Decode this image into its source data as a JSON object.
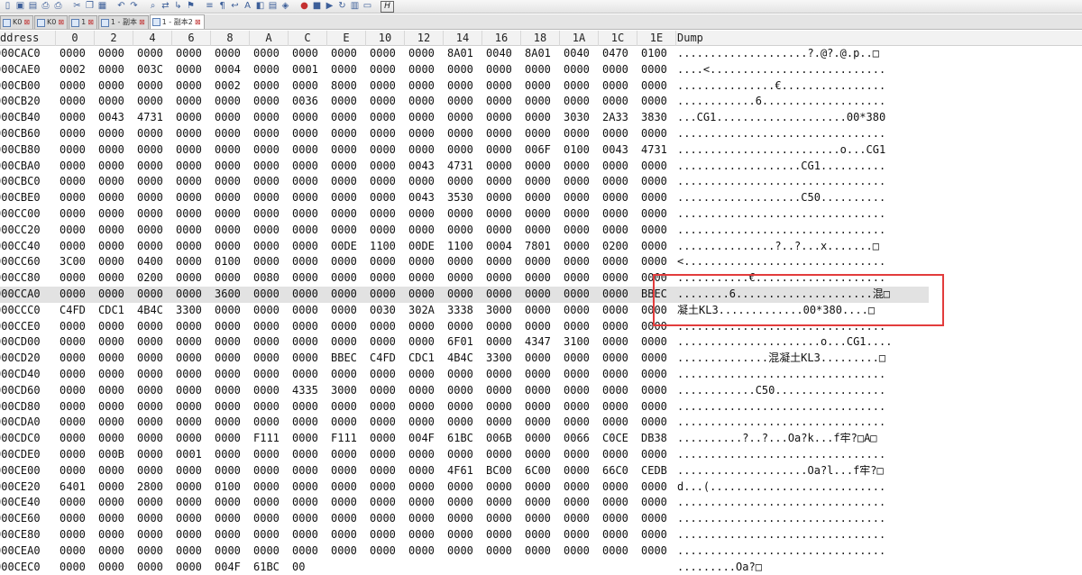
{
  "toolbar": {
    "icons": [
      "new-file-icon",
      "save-icon",
      "save-all-icon",
      "print-preview-icon",
      "print-icon",
      "cut-icon",
      "copy-icon",
      "paste-icon",
      "undo-icon",
      "redo-icon",
      "find-icon",
      "replace-icon",
      "goto-icon",
      "bookmark-icon",
      "compare-icon",
      "column-icon",
      "wrap-icon",
      "font-icon",
      "color-icon",
      "format-icon",
      "tag-icon",
      "record-macro-icon",
      "stop-macro-icon",
      "play-macro-icon",
      "repeat-macro-icon",
      "save-macro-icon",
      "window-icon",
      "hex-mode-icon"
    ],
    "hex_button_label": "H"
  },
  "tabs": [
    {
      "label": "K0",
      "active": false
    },
    {
      "label": "K0",
      "active": false
    },
    {
      "label": "1",
      "active": false
    },
    {
      "label": "1 - 副本",
      "active": false
    },
    {
      "label": "1 - 副本2",
      "active": true
    }
  ],
  "header": {
    "address": "ddress",
    "columns": [
      "0",
      "2",
      "4",
      "6",
      "8",
      "A",
      "C",
      "E",
      "10",
      "12",
      "14",
      "16",
      "18",
      "1A",
      "1C",
      "1E"
    ],
    "dump": "Dump"
  },
  "rows": [
    {
      "addr": "000CAC0",
      "words": [
        "0000",
        "0000",
        "0000",
        "0000",
        "0000",
        "0000",
        "0000",
        "0000",
        "0000",
        "0000",
        "8A01",
        "0040",
        "8A01",
        "0040",
        "0470",
        "0100"
      ],
      "dump": "....................?.@?.@.p..□"
    },
    {
      "addr": "000CAE0",
      "words": [
        "0002",
        "0000",
        "003C",
        "0000",
        "0004",
        "0000",
        "0001",
        "0000",
        "0000",
        "0000",
        "0000",
        "0000",
        "0000",
        "0000",
        "0000",
        "0000"
      ],
      "dump": "....<..........................."
    },
    {
      "addr": "000CB00",
      "words": [
        "0000",
        "0000",
        "0000",
        "0000",
        "0002",
        "0000",
        "0000",
        "8000",
        "0000",
        "0000",
        "0000",
        "0000",
        "0000",
        "0000",
        "0000",
        "0000"
      ],
      "dump": "...............€................"
    },
    {
      "addr": "000CB20",
      "words": [
        "0000",
        "0000",
        "0000",
        "0000",
        "0000",
        "0000",
        "0036",
        "0000",
        "0000",
        "0000",
        "0000",
        "0000",
        "0000",
        "0000",
        "0000",
        "0000"
      ],
      "dump": "............6..................."
    },
    {
      "addr": "000CB40",
      "words": [
        "0000",
        "0043",
        "4731",
        "0000",
        "0000",
        "0000",
        "0000",
        "0000",
        "0000",
        "0000",
        "0000",
        "0000",
        "0000",
        "3030",
        "2A33",
        "3830"
      ],
      "dump": "...CG1....................00*380"
    },
    {
      "addr": "000CB60",
      "words": [
        "0000",
        "0000",
        "0000",
        "0000",
        "0000",
        "0000",
        "0000",
        "0000",
        "0000",
        "0000",
        "0000",
        "0000",
        "0000",
        "0000",
        "0000",
        "0000"
      ],
      "dump": "................................"
    },
    {
      "addr": "000CB80",
      "words": [
        "0000",
        "0000",
        "0000",
        "0000",
        "0000",
        "0000",
        "0000",
        "0000",
        "0000",
        "0000",
        "0000",
        "0000",
        "006F",
        "0100",
        "0043",
        "4731"
      ],
      "dump": ".........................o...CG1"
    },
    {
      "addr": "000CBA0",
      "words": [
        "0000",
        "0000",
        "0000",
        "0000",
        "0000",
        "0000",
        "0000",
        "0000",
        "0000",
        "0043",
        "4731",
        "0000",
        "0000",
        "0000",
        "0000",
        "0000"
      ],
      "dump": "...................CG1.........."
    },
    {
      "addr": "000CBC0",
      "words": [
        "0000",
        "0000",
        "0000",
        "0000",
        "0000",
        "0000",
        "0000",
        "0000",
        "0000",
        "0000",
        "0000",
        "0000",
        "0000",
        "0000",
        "0000",
        "0000"
      ],
      "dump": "................................"
    },
    {
      "addr": "000CBE0",
      "words": [
        "0000",
        "0000",
        "0000",
        "0000",
        "0000",
        "0000",
        "0000",
        "0000",
        "0000",
        "0043",
        "3530",
        "0000",
        "0000",
        "0000",
        "0000",
        "0000"
      ],
      "dump": "...................C50.........."
    },
    {
      "addr": "000CC00",
      "words": [
        "0000",
        "0000",
        "0000",
        "0000",
        "0000",
        "0000",
        "0000",
        "0000",
        "0000",
        "0000",
        "0000",
        "0000",
        "0000",
        "0000",
        "0000",
        "0000"
      ],
      "dump": "................................"
    },
    {
      "addr": "000CC20",
      "words": [
        "0000",
        "0000",
        "0000",
        "0000",
        "0000",
        "0000",
        "0000",
        "0000",
        "0000",
        "0000",
        "0000",
        "0000",
        "0000",
        "0000",
        "0000",
        "0000"
      ],
      "dump": "................................"
    },
    {
      "addr": "000CC40",
      "words": [
        "0000",
        "0000",
        "0000",
        "0000",
        "0000",
        "0000",
        "0000",
        "00DE",
        "1100",
        "00DE",
        "1100",
        "0004",
        "7801",
        "0000",
        "0200",
        "0000"
      ],
      "dump": "...............?..?...x.......□"
    },
    {
      "addr": "000CC60",
      "words": [
        "3C00",
        "0000",
        "0400",
        "0000",
        "0100",
        "0000",
        "0000",
        "0000",
        "0000",
        "0000",
        "0000",
        "0000",
        "0000",
        "0000",
        "0000",
        "0000"
      ],
      "dump": "<..............................."
    },
    {
      "addr": "000CC80",
      "words": [
        "0000",
        "0000",
        "0200",
        "0000",
        "0000",
        "0080",
        "0000",
        "0000",
        "0000",
        "0000",
        "0000",
        "0000",
        "0000",
        "0000",
        "0000",
        "0000"
      ],
      "dump": "...........€...................."
    },
    {
      "addr": "000CCA0",
      "words": [
        "0000",
        "0000",
        "0000",
        "0000",
        "3600",
        "0000",
        "0000",
        "0000",
        "0000",
        "0000",
        "0000",
        "0000",
        "0000",
        "0000",
        "0000",
        "BBEC"
      ],
      "dump": "........6.....................混□",
      "highlight": true
    },
    {
      "addr": "000CCC0",
      "words": [
        "C4FD",
        "CDC1",
        "4B4C",
        "3300",
        "0000",
        "0000",
        "0000",
        "0000",
        "0030",
        "302A",
        "3338",
        "3000",
        "0000",
        "0000",
        "0000",
        "0000"
      ],
      "dump": "凝土KL3.............00*380....□"
    },
    {
      "addr": "000CCE0",
      "words": [
        "0000",
        "0000",
        "0000",
        "0000",
        "0000",
        "0000",
        "0000",
        "0000",
        "0000",
        "0000",
        "0000",
        "0000",
        "0000",
        "0000",
        "0000",
        "0000"
      ],
      "dump": "................................"
    },
    {
      "addr": "000CD00",
      "words": [
        "0000",
        "0000",
        "0000",
        "0000",
        "0000",
        "0000",
        "0000",
        "0000",
        "0000",
        "0000",
        "6F01",
        "0000",
        "4347",
        "3100",
        "0000",
        "0000"
      ],
      "dump": "......................o...CG1...."
    },
    {
      "addr": "000CD20",
      "words": [
        "0000",
        "0000",
        "0000",
        "0000",
        "0000",
        "0000",
        "0000",
        "BBEC",
        "C4FD",
        "CDC1",
        "4B4C",
        "3300",
        "0000",
        "0000",
        "0000",
        "0000"
      ],
      "dump": "..............混凝土KL3.........□"
    },
    {
      "addr": "000CD40",
      "words": [
        "0000",
        "0000",
        "0000",
        "0000",
        "0000",
        "0000",
        "0000",
        "0000",
        "0000",
        "0000",
        "0000",
        "0000",
        "0000",
        "0000",
        "0000",
        "0000"
      ],
      "dump": "................................"
    },
    {
      "addr": "000CD60",
      "words": [
        "0000",
        "0000",
        "0000",
        "0000",
        "0000",
        "0000",
        "4335",
        "3000",
        "0000",
        "0000",
        "0000",
        "0000",
        "0000",
        "0000",
        "0000",
        "0000"
      ],
      "dump": "............C50................."
    },
    {
      "addr": "000CD80",
      "words": [
        "0000",
        "0000",
        "0000",
        "0000",
        "0000",
        "0000",
        "0000",
        "0000",
        "0000",
        "0000",
        "0000",
        "0000",
        "0000",
        "0000",
        "0000",
        "0000"
      ],
      "dump": "................................"
    },
    {
      "addr": "000CDA0",
      "words": [
        "0000",
        "0000",
        "0000",
        "0000",
        "0000",
        "0000",
        "0000",
        "0000",
        "0000",
        "0000",
        "0000",
        "0000",
        "0000",
        "0000",
        "0000",
        "0000"
      ],
      "dump": "................................"
    },
    {
      "addr": "000CDC0",
      "words": [
        "0000",
        "0000",
        "0000",
        "0000",
        "0000",
        "F111",
        "0000",
        "F111",
        "0000",
        "004F",
        "61BC",
        "006B",
        "0000",
        "0066",
        "C0CE",
        "DB38"
      ],
      "dump": "..........?..?...Oa?k...f牢?□A□"
    },
    {
      "addr": "000CDE0",
      "words": [
        "0000",
        "000B",
        "0000",
        "0001",
        "0000",
        "0000",
        "0000",
        "0000",
        "0000",
        "0000",
        "0000",
        "0000",
        "0000",
        "0000",
        "0000",
        "0000"
      ],
      "dump": "................................"
    },
    {
      "addr": "000CE00",
      "words": [
        "0000",
        "0000",
        "0000",
        "0000",
        "0000",
        "0000",
        "0000",
        "0000",
        "0000",
        "0000",
        "4F61",
        "BC00",
        "6C00",
        "0000",
        "66C0",
        "CEDB"
      ],
      "dump": "....................Oa?l...f牢?□"
    },
    {
      "addr": "000CE20",
      "words": [
        "6401",
        "0000",
        "2800",
        "0000",
        "0100",
        "0000",
        "0000",
        "0000",
        "0000",
        "0000",
        "0000",
        "0000",
        "0000",
        "0000",
        "0000",
        "0000"
      ],
      "dump": "d...(..........................."
    },
    {
      "addr": "000CE40",
      "words": [
        "0000",
        "0000",
        "0000",
        "0000",
        "0000",
        "0000",
        "0000",
        "0000",
        "0000",
        "0000",
        "0000",
        "0000",
        "0000",
        "0000",
        "0000",
        "0000"
      ],
      "dump": "................................"
    },
    {
      "addr": "000CE60",
      "words": [
        "0000",
        "0000",
        "0000",
        "0000",
        "0000",
        "0000",
        "0000",
        "0000",
        "0000",
        "0000",
        "0000",
        "0000",
        "0000",
        "0000",
        "0000",
        "0000"
      ],
      "dump": "................................"
    },
    {
      "addr": "000CE80",
      "words": [
        "0000",
        "0000",
        "0000",
        "0000",
        "0000",
        "0000",
        "0000",
        "0000",
        "0000",
        "0000",
        "0000",
        "0000",
        "0000",
        "0000",
        "0000",
        "0000"
      ],
      "dump": "................................"
    },
    {
      "addr": "000CEA0",
      "words": [
        "0000",
        "0000",
        "0000",
        "0000",
        "0000",
        "0000",
        "0000",
        "0000",
        "0000",
        "0000",
        "0000",
        "0000",
        "0000",
        "0000",
        "0000",
        "0000"
      ],
      "dump": "................................"
    },
    {
      "addr": "000CEC0",
      "words": [
        "0000",
        "0000",
        "0000",
        "0000",
        "004F",
        "61BC",
        "00",
        "",
        "",
        "",
        "",
        "",
        "",
        "",
        "",
        ""
      ],
      "dump": ".........Oa?□"
    }
  ],
  "callout": {
    "color": "#e23c3c"
  }
}
